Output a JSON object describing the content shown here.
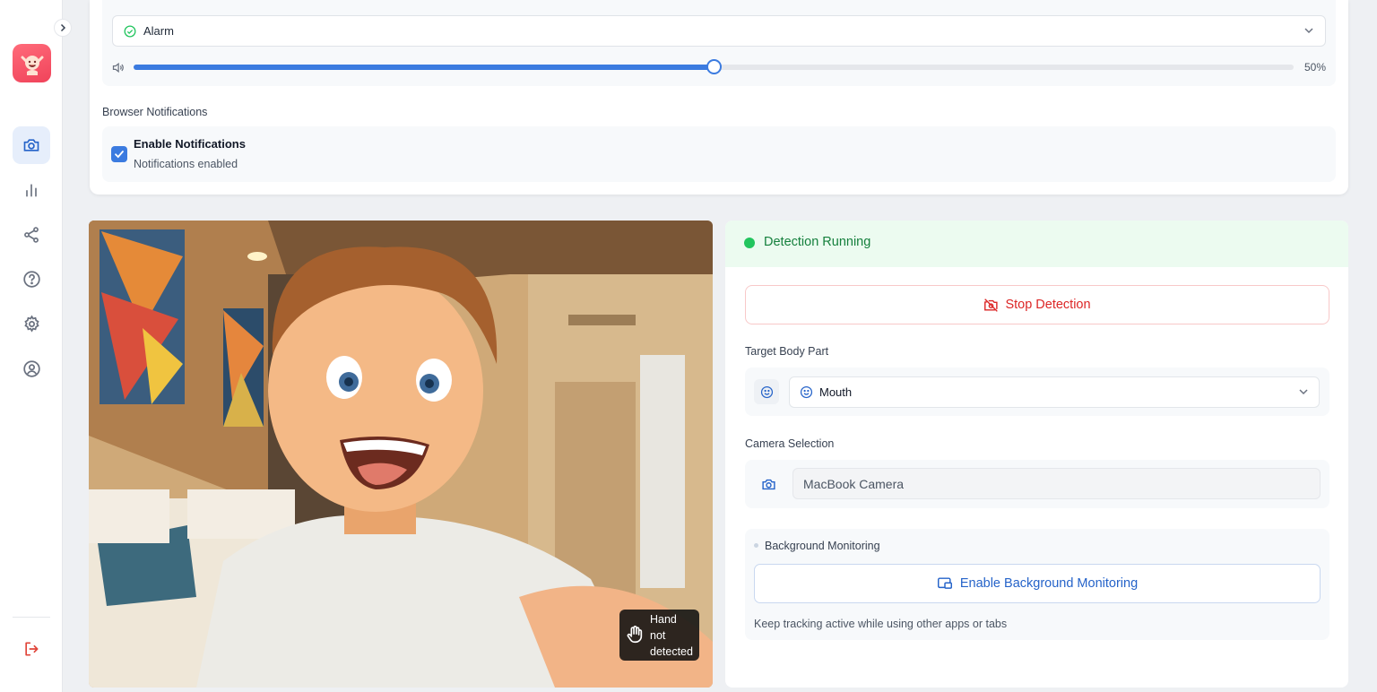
{
  "sound": {
    "selected": "Alarm",
    "volume_percent": 50,
    "volume_label": "50%"
  },
  "notifications": {
    "section_label": "Browser Notifications",
    "checkbox_checked": true,
    "title": "Enable Notifications",
    "status": "Notifications enabled"
  },
  "camera": {
    "hand_status": [
      "Hand",
      "not",
      "detected"
    ]
  },
  "detection": {
    "status": "Detection Running",
    "stop_label": "Stop Detection"
  },
  "target": {
    "label": "Target Body Part",
    "selected": "Mouth"
  },
  "camera_selection": {
    "label": "Camera Selection",
    "value": "MacBook Camera"
  },
  "background": {
    "label": "Background Monitoring",
    "button_label": "Enable Background Monitoring",
    "help": "Keep tracking active while using other apps or tabs"
  },
  "sidebar": {
    "items": [
      {
        "icon": "camera-icon",
        "active": true
      },
      {
        "icon": "bar-chart-icon",
        "active": false
      },
      {
        "icon": "share-icon",
        "active": false
      },
      {
        "icon": "help-circle-icon",
        "active": false
      },
      {
        "icon": "gear-icon",
        "active": false
      },
      {
        "icon": "user-circle-icon",
        "active": false
      }
    ],
    "bottom": {
      "icon": "logout-icon"
    }
  },
  "colors": {
    "accent": "#3b7be0",
    "success": "#22c55e",
    "danger": "#dc2626",
    "brand": "#f0435a"
  }
}
